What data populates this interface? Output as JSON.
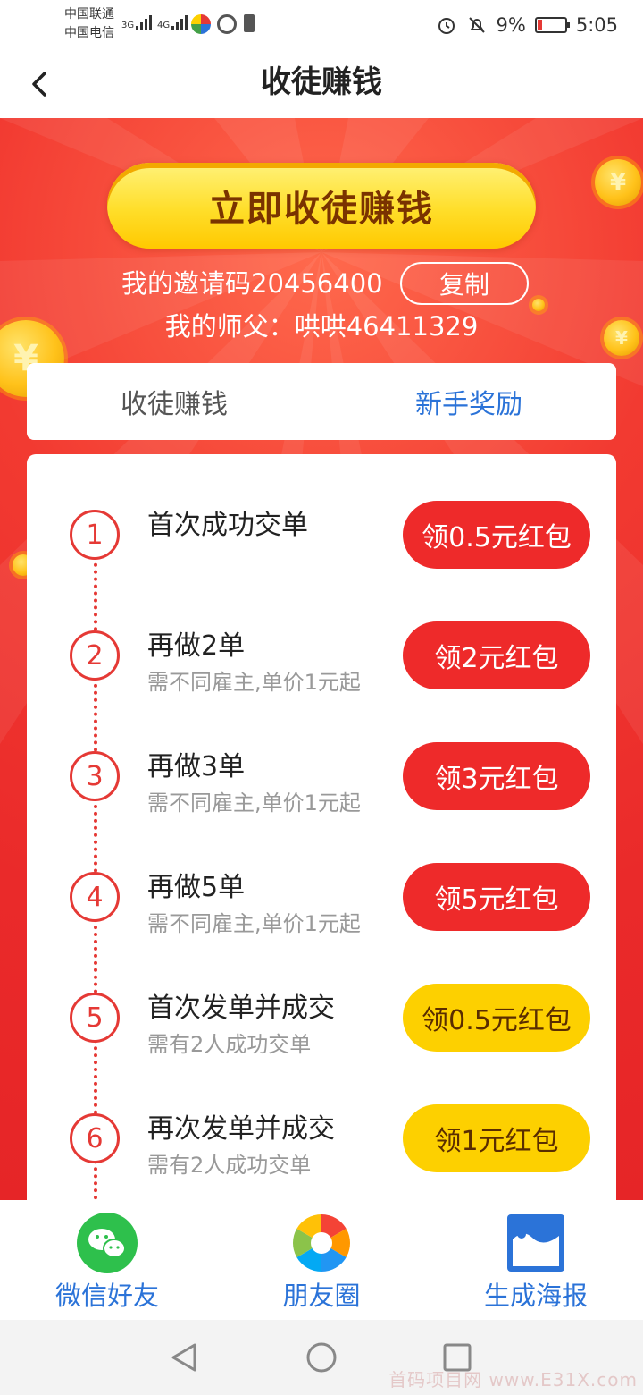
{
  "status_bar": {
    "carrier1": "中国联通",
    "carrier2": "中国电信",
    "net1": "3G",
    "net2": "4G",
    "battery": "9%",
    "time": "5:05"
  },
  "nav": {
    "title": "收徒赚钱"
  },
  "hero": {
    "cta_label": "立即收徒赚钱",
    "invite_text": "我的邀请码20456400",
    "copy_label": "复制",
    "master_text": "我的师父：哄哄46411329"
  },
  "tabs": [
    {
      "label": "收徒赚钱",
      "active": false
    },
    {
      "label": "新手奖励",
      "active": true
    }
  ],
  "steps": [
    {
      "num": "1",
      "title": "首次成功交单",
      "sub": "",
      "reward": "领0.5元红包",
      "color": "red"
    },
    {
      "num": "2",
      "title": "再做2单",
      "sub": "需不同雇主,单价1元起",
      "reward": "领2元红包",
      "color": "red"
    },
    {
      "num": "3",
      "title": "再做3单",
      "sub": "需不同雇主,单价1元起",
      "reward": "领3元红包",
      "color": "red"
    },
    {
      "num": "4",
      "title": "再做5单",
      "sub": "需不同雇主,单价1元起",
      "reward": "领5元红包",
      "color": "red"
    },
    {
      "num": "5",
      "title": "首次发单并成交",
      "sub": "需有2人成功交单",
      "reward": "领0.5元红包",
      "color": "yellow"
    },
    {
      "num": "6",
      "title": "再次发单并成交",
      "sub": "需有2人成功交单",
      "reward": "领1元红包",
      "color": "yellow"
    }
  ],
  "share": [
    {
      "label": "微信好友",
      "icon": "wechat-icon"
    },
    {
      "label": "朋友圈",
      "icon": "moments-icon"
    },
    {
      "label": "生成海报",
      "icon": "poster-icon"
    }
  ],
  "watermark": "首码项目网 www.E31X.com",
  "colors": {
    "accent_red": "#ee2a2a",
    "accent_yellow": "#fdd000",
    "link_blue": "#2b73d8"
  }
}
